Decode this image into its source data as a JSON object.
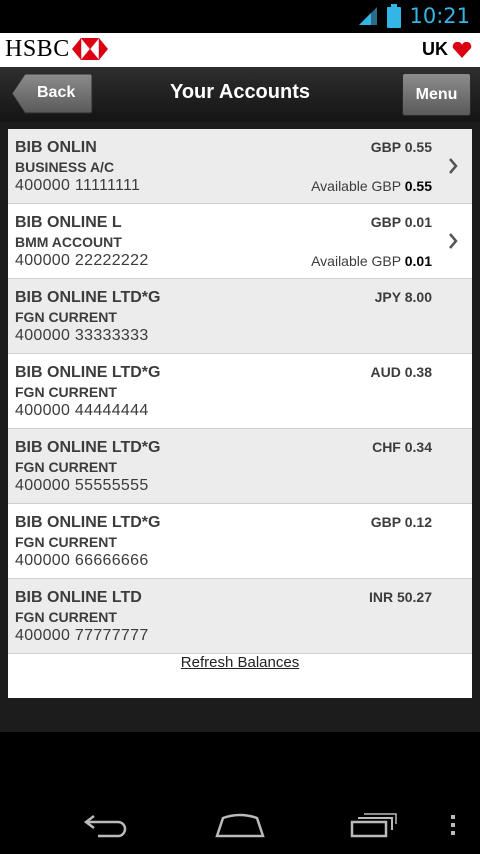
{
  "status": {
    "time": "10:21"
  },
  "brand": {
    "name": "HSBC",
    "region": "UK"
  },
  "header": {
    "back_label": "Back",
    "title": "Your Accounts",
    "menu_label": "Menu"
  },
  "accounts": [
    {
      "name": "BIB ONLIN",
      "type": "BUSINESS A/C",
      "number": "400000 11111111",
      "balance": "GBP 0.55",
      "available_label": "Available GBP",
      "available_value": "0.55"
    },
    {
      "name": "BIB ONLINE L",
      "type": "BMM ACCOUNT",
      "number": "400000 22222222",
      "balance": "GBP 0.01",
      "available_label": "Available GBP",
      "available_value": "0.01"
    },
    {
      "name": "BIB ONLINE LTD*G",
      "type": "FGN CURRENT",
      "number": "400000 33333333",
      "balance": "JPY 8.00"
    },
    {
      "name": "BIB ONLINE LTD*G",
      "type": "FGN CURRENT",
      "number": "400000 44444444",
      "balance": "AUD 0.38"
    },
    {
      "name": "BIB ONLINE LTD*G",
      "type": "FGN CURRENT",
      "number": "400000 55555555",
      "balance": "CHF 0.34"
    },
    {
      "name": "BIB ONLINE LTD*G",
      "type": "FGN CURRENT",
      "number": "400000 66666666",
      "balance": "GBP 0.12"
    },
    {
      "name": "BIB ONLINE LTD",
      "type": "FGN CURRENT",
      "number": "400000 77777777",
      "balance": "INR 50.27"
    }
  ],
  "refresh_label": "Refresh Balances",
  "icons": {
    "wifi": "wifi-icon",
    "battery": "battery-icon",
    "logo": "hsbc-hexagon-logo",
    "heart": "heart-icon",
    "chevron": "chevron-right-icon",
    "back": "back-nav-icon",
    "home": "home-nav-icon",
    "recents": "recent-apps-icon",
    "overflow": "overflow-menu-icon"
  },
  "colors": {
    "clock": "#33b5e5",
    "brand_red": "#db0011"
  }
}
